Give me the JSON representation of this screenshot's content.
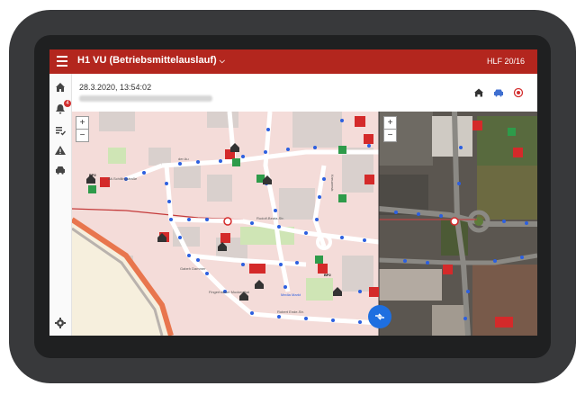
{
  "appbar": {
    "title": "H1 VU (Betriebsmittelauslauf)",
    "right": "HLF 20/16"
  },
  "sidebar": {
    "badge": "4"
  },
  "header": {
    "timestamp": "28.3.2020, 13:54:02"
  },
  "map": {
    "zoom_in": "+",
    "zoom_out": "−",
    "labels": [
      {
        "text": "der Au",
        "name": "street-label"
      },
      {
        "text": "Rudolf-Beata-Str.",
        "name": "street-label"
      },
      {
        "text": "Gabeh Dammer",
        "name": "street-label"
      },
      {
        "text": "Fingerhäuser Muckenthal",
        "name": "place-label"
      },
      {
        "text": "Robert Ende-Str.",
        "name": "street-label"
      },
      {
        "text": "Kreuzerstr.",
        "name": "street-label"
      },
      {
        "text": "Media Markt",
        "name": "place-label"
      },
      {
        "text": "Alt-Schillingstraße",
        "name": "street-label"
      },
      {
        "text": "BP2",
        "name": "marker-label"
      },
      {
        "text": "BP2",
        "name": "marker-label"
      }
    ]
  }
}
